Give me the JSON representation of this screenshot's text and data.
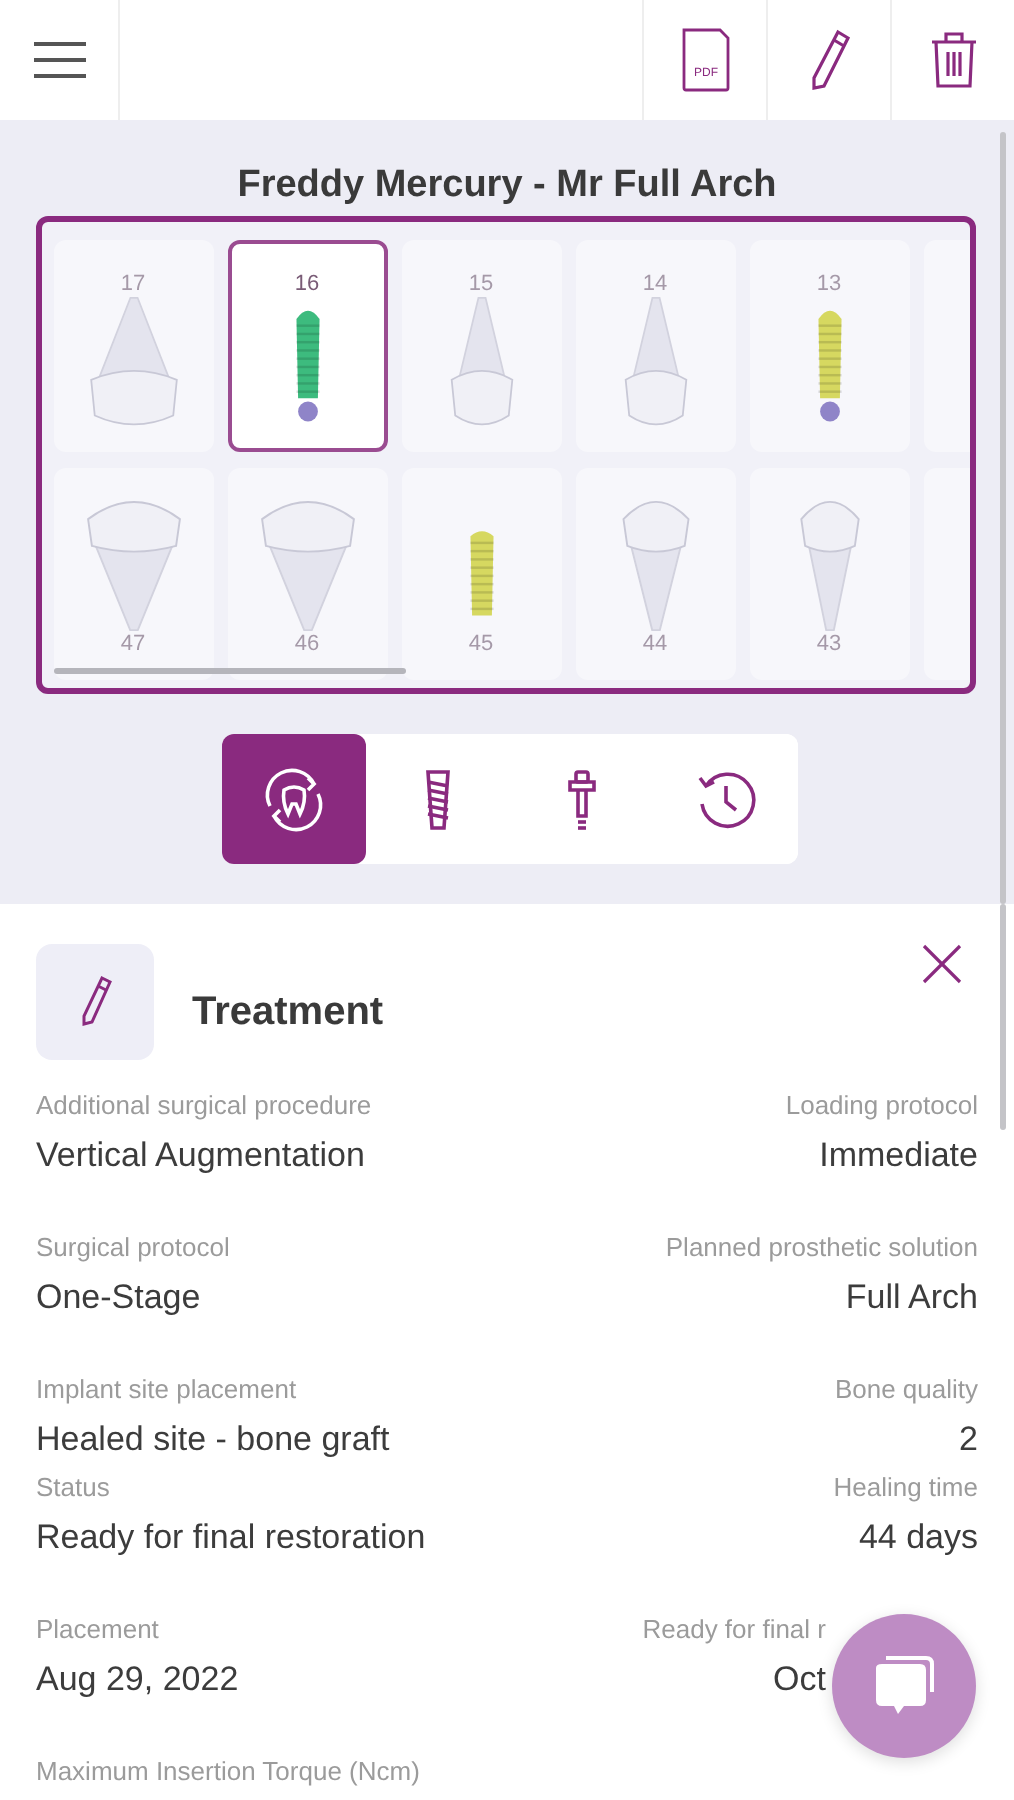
{
  "toolbar": {
    "actions": [
      {
        "kind": "pdf",
        "label": "PDF"
      },
      {
        "kind": "edit"
      },
      {
        "kind": "delete"
      }
    ]
  },
  "patient": {
    "title": "Freddy Mercury - Mr Full Arch"
  },
  "chart": {
    "rows": [
      [
        {
          "number": "17",
          "kind": "molar",
          "selected": false
        },
        {
          "number": "16",
          "kind": "implant",
          "color": "#3dbb7e",
          "selected": true
        },
        {
          "number": "15",
          "kind": "premolar",
          "selected": false
        },
        {
          "number": "14",
          "kind": "premolar",
          "selected": false
        },
        {
          "number": "13",
          "kind": "implant",
          "color": "#d6d860",
          "selected": false
        },
        {
          "kind": "partial",
          "selected": false
        }
      ],
      [
        {
          "number": "47",
          "kind": "molar",
          "selected": false
        },
        {
          "number": "46",
          "kind": "molar",
          "selected": false
        },
        {
          "number": "45",
          "kind": "implant",
          "color": "#d6d860",
          "selected": false
        },
        {
          "number": "44",
          "kind": "premolar",
          "selected": false
        },
        {
          "number": "43",
          "kind": "canine",
          "selected": false
        },
        {
          "kind": "partial",
          "selected": false
        }
      ]
    ]
  },
  "tabs": [
    {
      "kind": "treatment",
      "selected": true
    },
    {
      "kind": "implant",
      "selected": false
    },
    {
      "kind": "abutment",
      "selected": false
    },
    {
      "kind": "history",
      "selected": false
    }
  ],
  "panel": {
    "title": "Treatment",
    "fields": [
      [
        {
          "label": "Additional surgical procedure",
          "value": "Vertical Augmentation"
        },
        {
          "label": "Loading protocol",
          "value": "Immediate"
        }
      ],
      [
        {
          "label": "Surgical protocol",
          "value": "One-Stage"
        },
        {
          "label": "Planned prosthetic solution",
          "value": "Full Arch"
        }
      ],
      [
        {
          "label": "Implant site placement",
          "value": "Healed site - bone graft"
        },
        {
          "label": "Bone quality",
          "value": "2"
        }
      ],
      [
        {
          "label": "Status",
          "value": "Ready for final restoration"
        },
        {
          "label": "Healing time",
          "value": "44 days"
        }
      ],
      [
        {
          "label": "Placement",
          "value": "Aug 29, 2022"
        },
        {
          "label": "Ready for final r",
          "value": "Oct"
        }
      ],
      [
        {
          "label": "Maximum Insertion Torque (Ncm)"
        }
      ]
    ]
  }
}
